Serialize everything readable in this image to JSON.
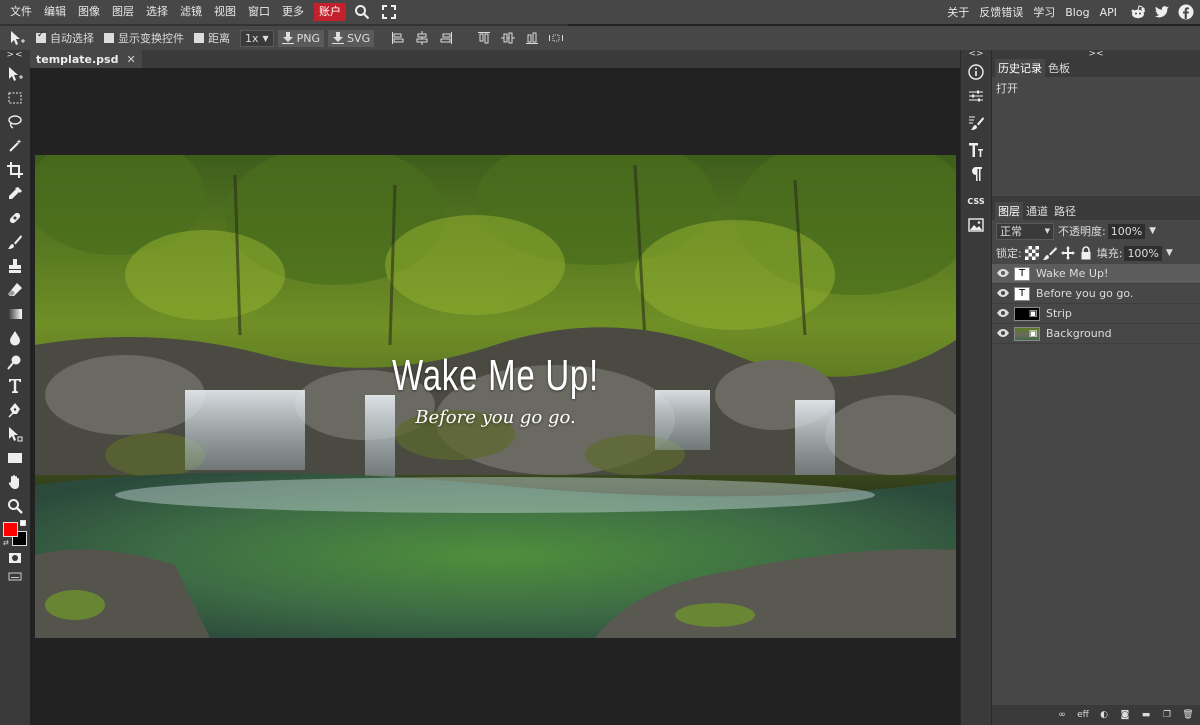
{
  "menubar": {
    "items": [
      "文件",
      "编辑",
      "图像",
      "图层",
      "选择",
      "滤镜",
      "视图",
      "窗口",
      "更多"
    ],
    "account": "账户",
    "links": [
      "关于",
      "反馈错误",
      "学习",
      "Blog",
      "API"
    ],
    "social_icons": [
      "reddit-icon",
      "twitter-icon",
      "facebook-icon"
    ]
  },
  "optbar": {
    "auto_select": "自动选择",
    "show_transform": "显示变换控件",
    "distance": "距离",
    "zoom": "1x",
    "export_png": "PNG",
    "export_svg": "SVG"
  },
  "document": {
    "tab_name": "template.psd",
    "close": "✕",
    "title_text": "Wake Me Up!",
    "subtitle_text": "Before you go go."
  },
  "colors": {
    "foreground": "#ff0000",
    "background": "#000000",
    "accent": "#c3202b"
  },
  "history_panel": {
    "tabs": [
      "历史记录",
      "色板"
    ],
    "active_tab": "历史记录",
    "entries": [
      "打开"
    ]
  },
  "layers_panel": {
    "tabs": [
      "图层",
      "通道",
      "路径"
    ],
    "active_tab": "图层",
    "blend_mode": "正常",
    "opacity_label": "不透明度:",
    "opacity_value": "100%",
    "lock_label": "锁定:",
    "fill_label": "填充:",
    "fill_value": "100%",
    "layers": [
      {
        "name": "Wake Me Up!",
        "type": "text",
        "selected": true
      },
      {
        "name": "Before you go go.",
        "type": "text",
        "selected": false
      },
      {
        "name": "Strip",
        "type": "shape",
        "selected": false
      },
      {
        "name": "Background",
        "type": "image",
        "selected": false
      }
    ],
    "bottom_buttons": [
      "link-icon",
      "eff",
      "adjust-icon",
      "mask-icon",
      "folder-icon",
      "new-layer-icon",
      "trash-icon"
    ]
  }
}
